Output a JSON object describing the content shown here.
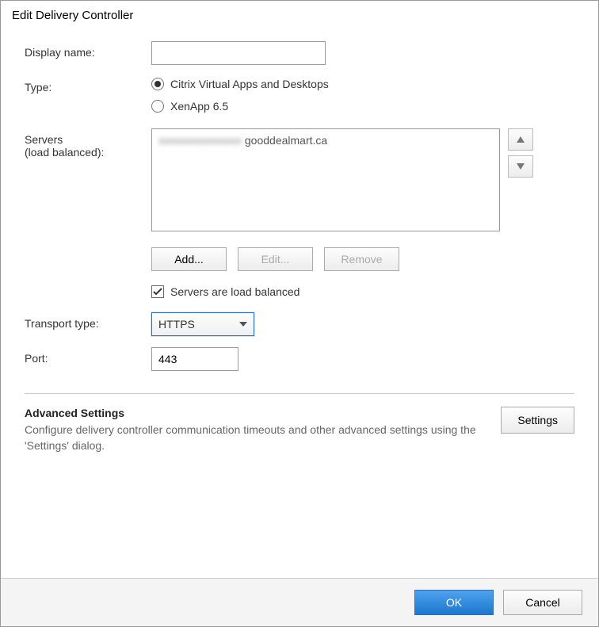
{
  "dialog": {
    "title": "Edit Delivery Controller"
  },
  "fields": {
    "display_name_label": "Display name:",
    "display_name_value": "",
    "type_label": "Type:",
    "type_options": {
      "cvad": "Citrix Virtual Apps and Desktops",
      "xenapp": "XenApp 6.5"
    },
    "type_selected": "cvad",
    "servers_label_line1": "Servers",
    "servers_label_line2": "(load balanced):",
    "servers": [
      {
        "prefix_obscured": "xxxxxxxxxxxxxxx",
        "suffix": "gooddealmart.ca"
      }
    ],
    "buttons": {
      "add": "Add...",
      "edit": "Edit...",
      "remove": "Remove"
    },
    "load_balanced_label": "Servers are load balanced",
    "load_balanced_checked": true,
    "transport_label": "Transport type:",
    "transport_value": "HTTPS",
    "port_label": "Port:",
    "port_value": "443"
  },
  "advanced": {
    "heading": "Advanced Settings",
    "description": "Configure delivery controller communication timeouts and other advanced settings using the 'Settings' dialog.",
    "button": "Settings"
  },
  "footer": {
    "ok": "OK",
    "cancel": "Cancel"
  }
}
